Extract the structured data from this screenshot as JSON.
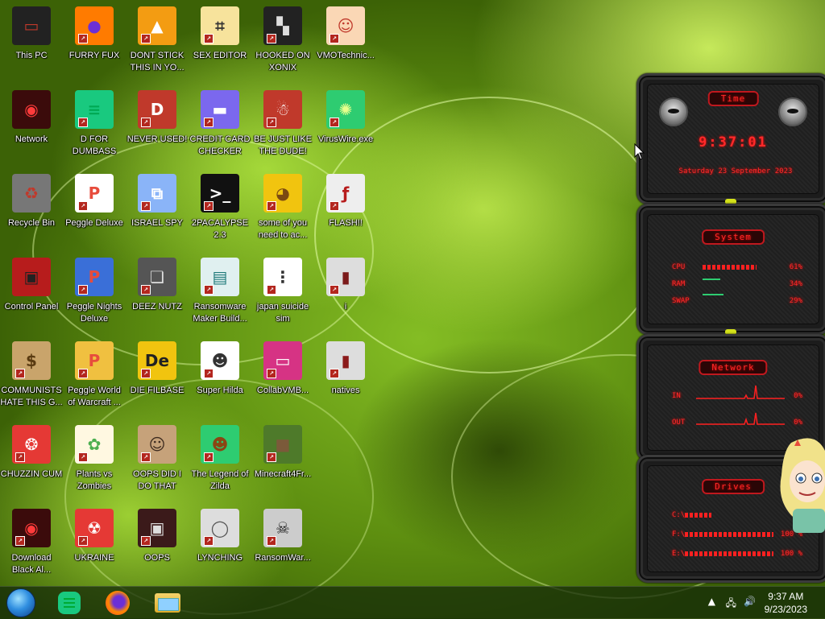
{
  "desktop": {
    "icons": [
      {
        "label": "This PC",
        "icon": "monitor-icon"
      },
      {
        "label": "FURRY FUX",
        "icon": "firefox-icon"
      },
      {
        "label": "DONT STICK THIS IN YO...",
        "icon": "cone-icon"
      },
      {
        "label": "SEX EDITOR",
        "icon": "hex-editor-icon"
      },
      {
        "label": "HOOKED ON XONIX",
        "icon": "xonix-icon"
      },
      {
        "label": "VMOTechnic...",
        "icon": "doctor-icon"
      },
      {
        "label": "Network",
        "icon": "network-orb-icon"
      },
      {
        "label": "D FOR DUMBASS",
        "icon": "chat-icon"
      },
      {
        "label": "NEVER USED!",
        "icon": "devcpp-icon"
      },
      {
        "label": "CREDIT CARD CHECKER",
        "icon": "credit-card-icon"
      },
      {
        "label": "BE JUST LIKE THE DUDE!",
        "icon": "santa-icon"
      },
      {
        "label": "VirusWire.exe",
        "icon": "lime-icon"
      },
      {
        "label": "Recycle Bin",
        "icon": "recycle-bin-icon"
      },
      {
        "label": "Peggle Deluxe",
        "icon": "peggle-icon"
      },
      {
        "label": "ISRAEL SPY",
        "icon": "network-computer-icon"
      },
      {
        "label": "2PACALYPSE 2.3",
        "icon": "terminal-icon"
      },
      {
        "label": "some of you need to ac...",
        "icon": "dog-icon"
      },
      {
        "label": "FLASH!!",
        "icon": "flash-icon"
      },
      {
        "label": "Control Panel",
        "icon": "control-panel-icon"
      },
      {
        "label": "Peggle Nights Deluxe",
        "icon": "peggle-nights-icon"
      },
      {
        "label": "DEEZ NUTZ",
        "icon": "stack-icon"
      },
      {
        "label": "Ransomware Maker Build...",
        "icon": "window-app-icon"
      },
      {
        "label": "japan suicide sim",
        "icon": "game-icon"
      },
      {
        "label": "i",
        "icon": "folder-dark-icon"
      },
      {
        "label": "COMMUNISTS HATE THIS G...",
        "icon": "money-bag-icon"
      },
      {
        "label": "Peggle World of Warcraft ...",
        "icon": "peggle-wow-icon"
      },
      {
        "label": "DIE FILBASE",
        "icon": "die-icon"
      },
      {
        "label": "Super Hilda",
        "icon": "pixel-character-icon"
      },
      {
        "label": "CollabVMB...",
        "icon": "monitor-pink-icon"
      },
      {
        "label": "natives",
        "icon": "folder-red-icon"
      },
      {
        "label": "CHUZZIN CUM",
        "icon": "chuzzle-icon"
      },
      {
        "label": "Plants vs Zombies",
        "icon": "plant-icon"
      },
      {
        "label": "OOPS DID I DO THAT",
        "icon": "portrait-icon"
      },
      {
        "label": "The Legend of Zilda",
        "icon": "hero-icon"
      },
      {
        "label": "Minecraft4Fr...",
        "icon": "grass-block-icon"
      },
      {
        "label": "Download Black Al...",
        "icon": "network-orb-icon"
      },
      {
        "label": "UKRAINE",
        "icon": "radiation-icon"
      },
      {
        "label": "OOPS",
        "icon": "box-icon"
      },
      {
        "label": "LYNCHING",
        "icon": "noose-icon"
      },
      {
        "label": "RansomWar...",
        "icon": "skull-icon"
      }
    ]
  },
  "widget": {
    "time": {
      "title": "Time",
      "clock": "9:37:01",
      "date": "Saturday 23 September 2023"
    },
    "system": {
      "title": "System",
      "rows": [
        {
          "label": "CPU",
          "value": "61%",
          "fraction": 0.61
        },
        {
          "label": "RAM",
          "value": "34%",
          "fraction": 0.34
        },
        {
          "label": "SWAP",
          "value": "29%",
          "fraction": 0.29
        }
      ]
    },
    "network": {
      "title": "Network",
      "rows": [
        {
          "label": "IN",
          "value": "0%"
        },
        {
          "label": "OUT",
          "value": "0%"
        }
      ]
    },
    "drives": {
      "title": "Drives",
      "rows": [
        {
          "label": "C:\\",
          "value": "",
          "fraction": 0.3
        },
        {
          "label": "F:\\",
          "value": "100 %",
          "fraction": 1.0
        },
        {
          "label": "E:\\",
          "value": "100 %",
          "fraction": 1.0
        }
      ]
    }
  },
  "taskbar": {
    "pinned": [
      "start-orb-icon",
      "chat-icon",
      "firefox-icon",
      "file-explorer-icon"
    ],
    "time": "9:37 AM",
    "date": "9/23/2023"
  },
  "colors": {
    "accent": "#ff2a2a",
    "wallpaper": "#84bd24"
  }
}
